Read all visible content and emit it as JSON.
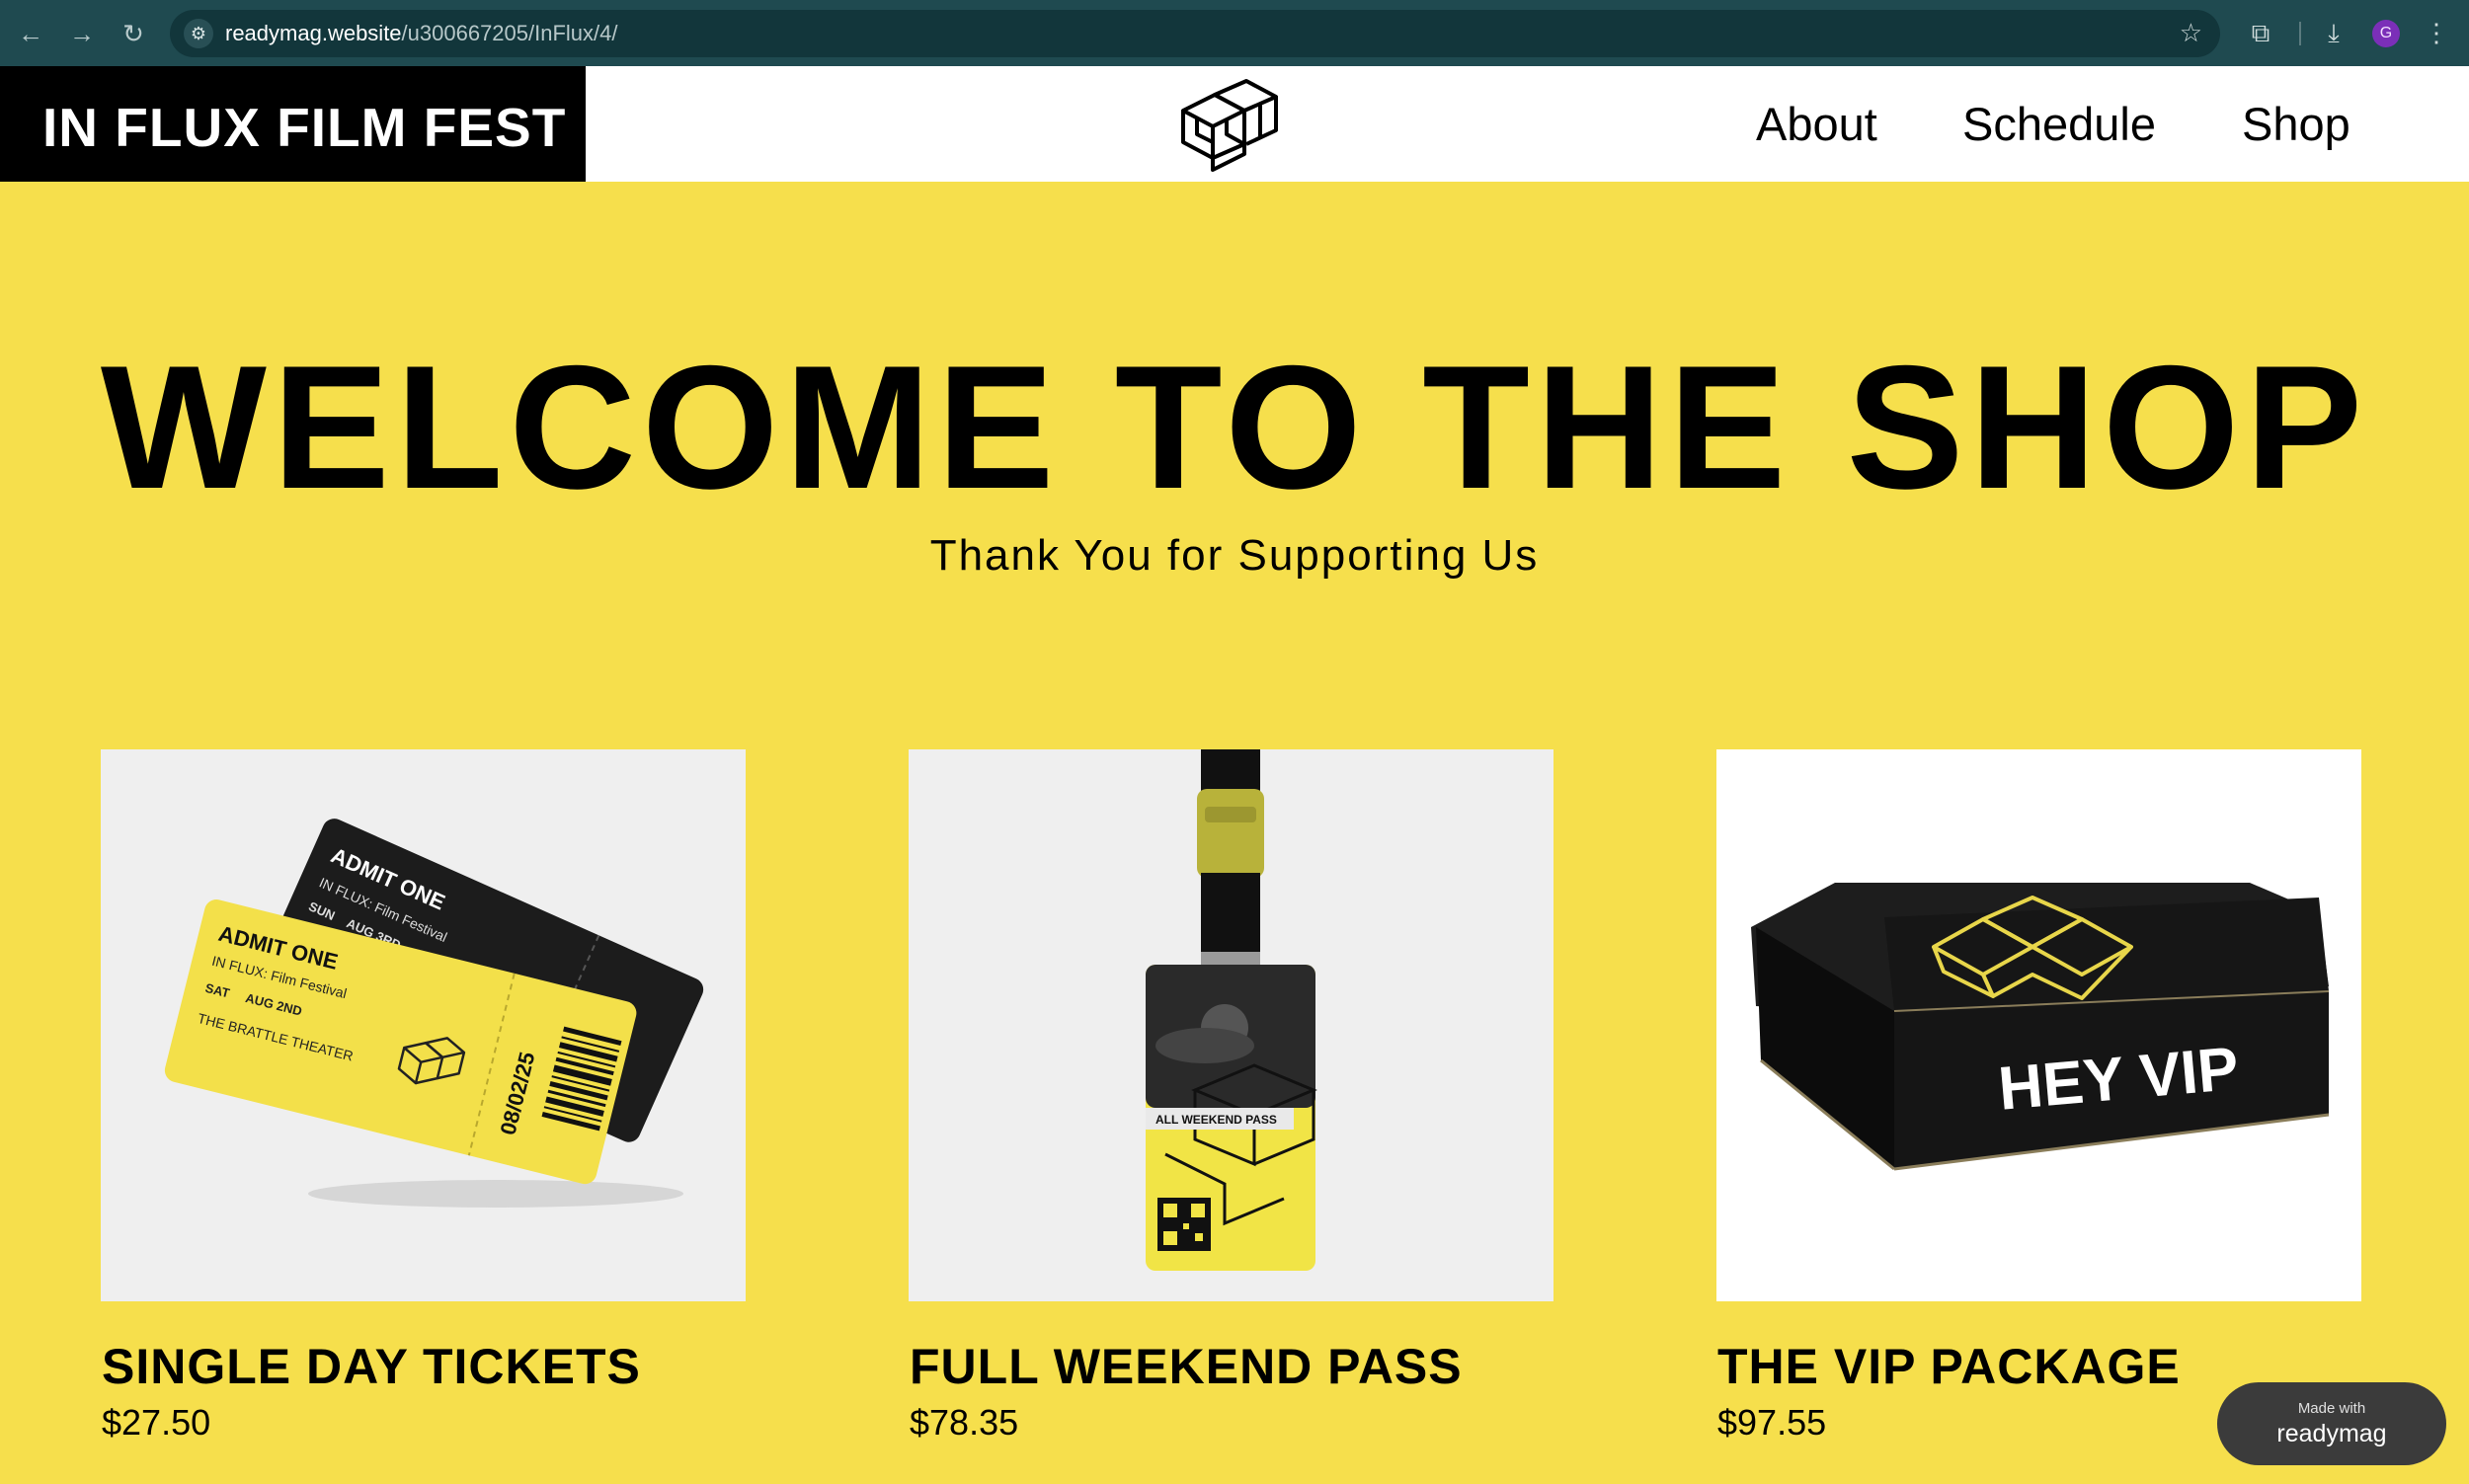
{
  "browser": {
    "url_host": "readymag.website",
    "url_path": "/u300667205/InFlux/4/",
    "profile_initial": "G"
  },
  "header": {
    "brand": "IN FLUX FILM FEST",
    "nav": [
      "About",
      "Schedule",
      "Shop"
    ]
  },
  "hero": {
    "title": "WELCOME TO THE SHOP",
    "subtitle": "Thank You for Supporting Us"
  },
  "products": [
    {
      "name": "SINGLE DAY TICKETS",
      "price": "$27.50",
      "image_text": {
        "admit": "ADMIT ONE",
        "fest": "IN FLUX: Film Festival",
        "sun": "SUN",
        "sun_date": "AUG 3RD",
        "sat": "SAT",
        "sat_date": "AUG 2ND",
        "venue": "THE BRATTLE THEATER",
        "stub_date": "08/02/25"
      }
    },
    {
      "name": "FULL WEEKEND PASS",
      "price": "$78.35",
      "image_text": {
        "label": "ALL WEEKEND PASS"
      }
    },
    {
      "name": "THE VIP PACKAGE",
      "price": "$97.55",
      "image_text": {
        "box": "HEY VIP"
      }
    }
  ],
  "badge": {
    "line1": "Made with",
    "line2": "readymag"
  },
  "colors": {
    "page_bg": "#f6df4c",
    "chrome": "#1f4a50",
    "accent_yellow": "#f3e04a"
  }
}
